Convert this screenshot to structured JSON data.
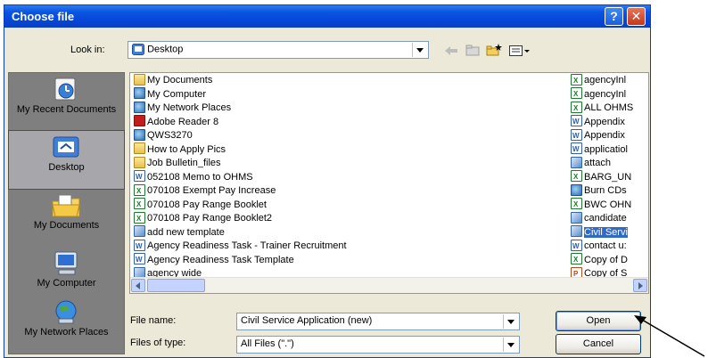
{
  "dialog": {
    "title": "Choose file",
    "help_glyph": "?",
    "close_glyph": "✕"
  },
  "lookin": {
    "label": "Look in:",
    "value": "Desktop",
    "icon": "desktop-icon"
  },
  "toolbar": {
    "back_icon": "back-arrow-icon",
    "up_icon": "up-folder-icon",
    "new_folder_icon": "new-folder-icon",
    "views_icon": "views-menu-icon"
  },
  "places": [
    {
      "label": "My Recent Documents",
      "icon": "recent-documents-icon",
      "selected": false
    },
    {
      "label": "Desktop",
      "icon": "desktop-icon",
      "selected": true
    },
    {
      "label": "My Documents",
      "icon": "my-documents-icon",
      "selected": false
    },
    {
      "label": "My Computer",
      "icon": "my-computer-icon",
      "selected": false
    },
    {
      "label": "My Network Places",
      "icon": "network-places-icon",
      "selected": false
    }
  ],
  "files_col1": [
    {
      "name": "My Documents",
      "type": "folder"
    },
    {
      "name": "My Computer",
      "type": "sys"
    },
    {
      "name": "My Network Places",
      "type": "sys"
    },
    {
      "name": "Adobe Reader 8",
      "type": "pdf"
    },
    {
      "name": "QWS3270",
      "type": "sys"
    },
    {
      "name": "How to Apply Pics",
      "type": "folder"
    },
    {
      "name": "Job Bulletin_files",
      "type": "folder"
    },
    {
      "name": "052108 Memo to OHMS",
      "type": "doc"
    },
    {
      "name": "070108 Exempt Pay Increase",
      "type": "xls"
    },
    {
      "name": "070108 Pay Range Booklet",
      "type": "xls"
    },
    {
      "name": "070108 Pay Range Booklet2",
      "type": "xls"
    },
    {
      "name": "add new template",
      "type": "lnk"
    },
    {
      "name": "Agency Readiness Task - Trainer Recruitment",
      "type": "doc"
    },
    {
      "name": "Agency Readiness Task Template",
      "type": "doc"
    },
    {
      "name": "agency wide",
      "type": "lnk"
    }
  ],
  "files_col2": [
    {
      "name": "agencyInl",
      "type": "xls",
      "selected": false
    },
    {
      "name": "agencyInl",
      "type": "xls",
      "selected": false
    },
    {
      "name": "ALL OHMS",
      "type": "xls",
      "selected": false
    },
    {
      "name": "Appendix",
      "type": "doc",
      "selected": false
    },
    {
      "name": "Appendix",
      "type": "doc",
      "selected": false
    },
    {
      "name": "applicatiol",
      "type": "doc",
      "selected": false
    },
    {
      "name": "attach",
      "type": "lnk",
      "selected": false
    },
    {
      "name": "BARG_UN",
      "type": "xls",
      "selected": false
    },
    {
      "name": "Burn CDs",
      "type": "sys",
      "selected": false
    },
    {
      "name": "BWC OHN",
      "type": "xls",
      "selected": false
    },
    {
      "name": "candidate",
      "type": "lnk",
      "selected": false
    },
    {
      "name": "Civil Servi",
      "type": "lnk",
      "selected": true
    },
    {
      "name": "contact u:",
      "type": "doc",
      "selected": false
    },
    {
      "name": "Copy of D",
      "type": "xls",
      "selected": false
    },
    {
      "name": "Copy of S",
      "type": "ppt",
      "selected": false
    }
  ],
  "filename": {
    "label": "File name:",
    "value": "Civil Service Application (new)"
  },
  "filetype": {
    "label": "Files of type:",
    "value": "All Files (\".\")"
  },
  "buttons": {
    "open": "Open",
    "cancel": "Cancel"
  },
  "colors": {
    "title_bar": "#0a55e0",
    "dialog_bg": "#ece9d8",
    "places_bg": "#7f7f7f",
    "selection": "#316ac5"
  }
}
